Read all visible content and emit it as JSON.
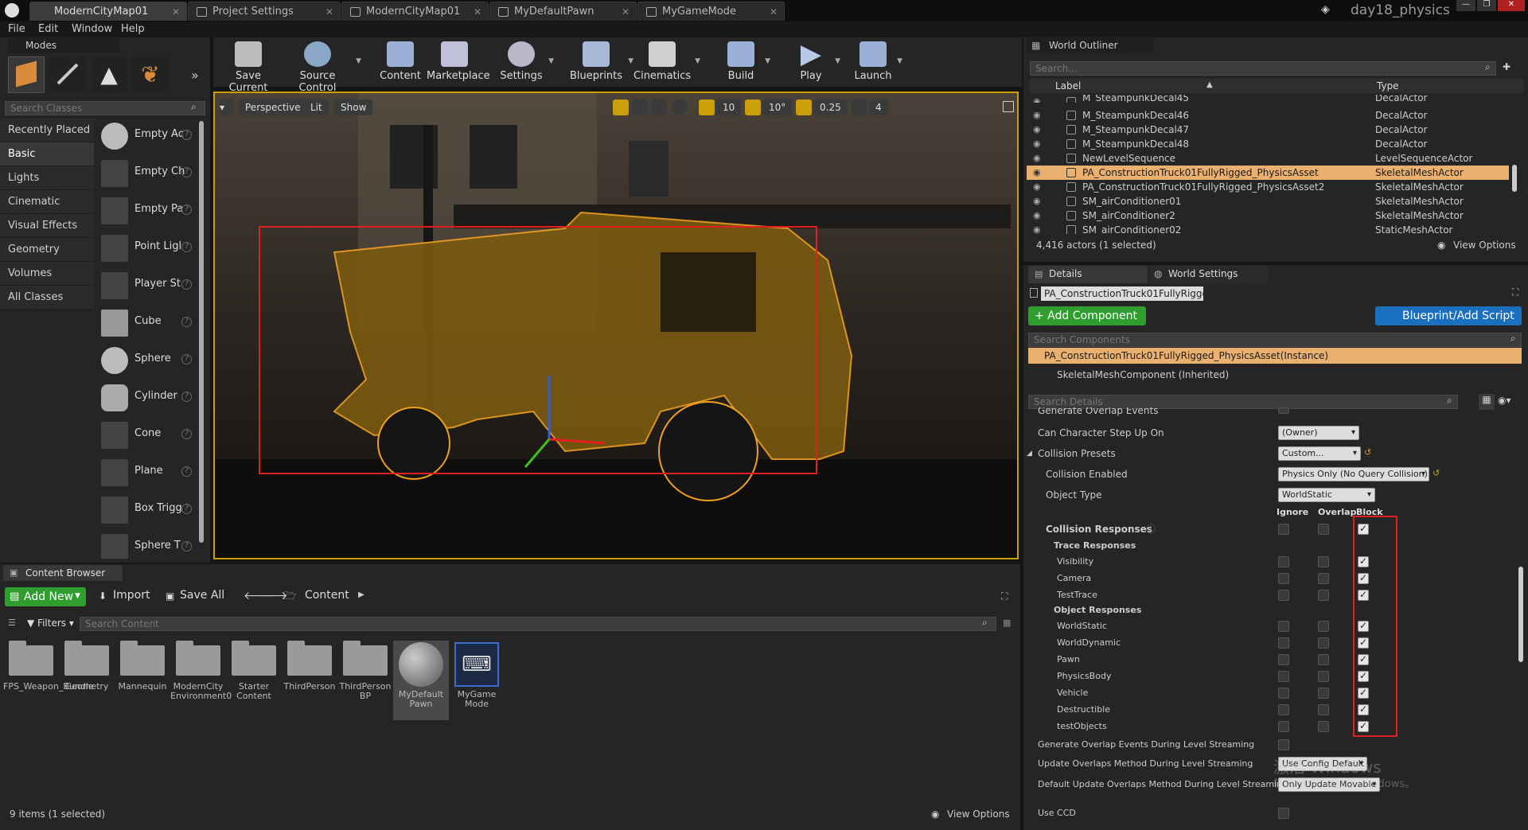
{
  "tabs": [
    {
      "label": "ModernCityMap01",
      "active": true
    },
    {
      "label": "Project Settings",
      "active": false
    },
    {
      "label": "ModernCityMap01",
      "active": false
    },
    {
      "label": "MyDefaultPawn",
      "active": false
    },
    {
      "label": "MyGameMode",
      "active": false
    }
  ],
  "project_name": "day18_physics",
  "menu": [
    "File",
    "Edit",
    "Window",
    "Help"
  ],
  "modes": {
    "title": "Modes",
    "search_placeholder": "Search Classes",
    "categories": [
      "Recently Placed",
      "Basic",
      "Lights",
      "Cinematic",
      "Visual Effects",
      "Geometry",
      "Volumes",
      "All Classes"
    ],
    "items": [
      "Empty Ac",
      "Empty Ch",
      "Empty Pa",
      "Point Ligl",
      "Player St",
      "Cube",
      "Sphere",
      "Cylinder",
      "Cone",
      "Plane",
      "Box Trigg",
      "Sphere T"
    ]
  },
  "toolbar": [
    "Save Current",
    "Source Control",
    "Content",
    "Marketplace",
    "Settings",
    "Blueprints",
    "Cinematics",
    "Build",
    "Play",
    "Launch"
  ],
  "viewport": {
    "perspective": "Perspective",
    "lit": "Lit",
    "show": "Show",
    "grid": "10",
    "angle": "10°",
    "scale": "0.25",
    "cam": "4"
  },
  "outliner": {
    "title": "World Outliner",
    "search_placeholder": "Search...",
    "col_label": "Label",
    "col_type": "Type",
    "rows": [
      {
        "label": "M_SteampunkDecal45",
        "type": "DecalActor"
      },
      {
        "label": "M_SteampunkDecal46",
        "type": "DecalActor"
      },
      {
        "label": "M_SteampunkDecal47",
        "type": "DecalActor"
      },
      {
        "label": "M_SteampunkDecal48",
        "type": "DecalActor"
      },
      {
        "label": "NewLevelSequence",
        "type": "LevelSequenceActor"
      },
      {
        "label": "PA_ConstructionTruck01FullyRigged_PhysicsAsset",
        "type": "SkeletalMeshActor"
      },
      {
        "label": "PA_ConstructionTruck01FullyRigged_PhysicsAsset2",
        "type": "SkeletalMeshActor"
      },
      {
        "label": "SM_airConditioner01",
        "type": "SkeletalMeshActor"
      },
      {
        "label": "SM_airConditioner2",
        "type": "SkeletalMeshActor"
      },
      {
        "label": "SM_airConditioner02",
        "type": "StaticMeshActor"
      }
    ],
    "status": "4,416 actors (1 selected)",
    "view_options": "View Options"
  },
  "details": {
    "tab_details": "Details",
    "tab_world_settings": "World Settings",
    "actor_name": "PA_ConstructionTruck01FullyRigge",
    "add_component": "+ Add Component",
    "blueprint": "Blueprint/Add Script",
    "search_components": "Search Components",
    "instance": "PA_ConstructionTruck01FullyRigged_PhysicsAsset(Instance)",
    "component": "SkeletalMeshComponent (Inherited)",
    "search_details": "Search Details",
    "generate_overlap": "Generate Overlap Events",
    "step_up": "Can Character Step Up On",
    "step_up_val": "(Owner)",
    "presets": "Collision Presets",
    "presets_val": "Custom...",
    "enabled": "Collision Enabled",
    "enabled_val": "Physics Only (No Query Collision)",
    "object_type": "Object Type",
    "object_type_val": "WorldStatic",
    "col_ignore": "Ignore",
    "col_overlap": "Overlap",
    "col_block": "Block",
    "responses": "Collision Responses",
    "trace": "Trace Responses",
    "trace_items": [
      "Visibility",
      "Camera",
      "TestTrace"
    ],
    "object": "Object Responses",
    "object_items": [
      "WorldStatic",
      "WorldDynamic",
      "Pawn",
      "PhysicsBody",
      "Vehicle",
      "Destructible",
      "testObjects"
    ],
    "gen_streaming": "Generate Overlap Events During Level Streaming",
    "update_method": "Update Overlaps Method During Level Streaming",
    "update_method_val": "Use Config Default",
    "default_update": "Default Update Overlaps Method During Level Streaming",
    "default_update_val": "Only Update Movable",
    "use_ccd": "Use CCD"
  },
  "content_browser": {
    "title": "Content Browser",
    "add_new": "Add New",
    "import": "Import",
    "save_all": "Save All",
    "path": "Content",
    "filters": "Filters",
    "search_placeholder": "Search Content",
    "assets": [
      "FPS_Weapon_Bundle",
      "Geometry",
      "Mannequin",
      "ModernCity Environment0",
      "Starter Content",
      "ThirdPerson",
      "ThirdPerson BP",
      "MyDefault Pawn",
      "MyGame Mode"
    ],
    "status": "9 items (1 selected)",
    "view_options": "View Options"
  },
  "watermark": "激活 Windows",
  "watermark_sub": "转到\"设置\"以激活 Windows。",
  "colors": {
    "selected": "#e9b06f",
    "add_green": "#2f9e2f",
    "blueprint_blue": "#1a6fbf",
    "highlight_red": "#e02020",
    "selection_orange": "#e0a020"
  }
}
